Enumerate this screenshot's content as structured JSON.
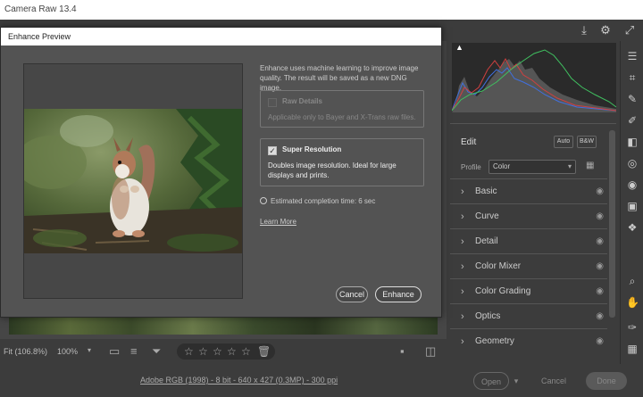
{
  "window": {
    "title": "Camera Raw 13.4"
  },
  "topbar": {
    "icons": [
      "save-icon",
      "gear-icon",
      "fullscreen-icon"
    ]
  },
  "bottombar": {
    "zoom_label": "Fit (106.8%)",
    "zoom_pct": "100%",
    "rating_stars": 5
  },
  "footer": {
    "info": "Adobe RGB (1998) - 8 bit - 640 x 427 (0.3MP) - 300 ppi",
    "open_label": "Open",
    "cancel_label": "Cancel",
    "done_label": "Done"
  },
  "right_panel": {
    "edit_title": "Edit",
    "auto_label": "Auto",
    "bw_label": "B&W",
    "profile_label": "Profile",
    "profile_value": "Color",
    "sections": [
      "Basic",
      "Curve",
      "Detail",
      "Color Mixer",
      "Color Grading",
      "Optics",
      "Geometry"
    ]
  },
  "dialog": {
    "title": "Enhance Preview",
    "description": "Enhance uses machine learning to improve image quality. The result will be saved as a new DNG image.",
    "raw_details": {
      "title": "Raw Details",
      "desc": "Applicable only to Bayer and X-Trans raw files.",
      "checked": false
    },
    "super_resolution": {
      "title": "Super Resolution",
      "desc": "Doubles image resolution. Ideal for large displays and prints.",
      "checked": true
    },
    "estimate": "Estimated completion time: 6 sec",
    "learn_more": "Learn More",
    "cancel_label": "Cancel",
    "enhance_label": "Enhance"
  },
  "colors": {
    "panel": "#3c3c3c",
    "dialog": "#535353",
    "hist_red": "#d04040",
    "hist_green": "#40c060",
    "hist_blue": "#4070e0"
  }
}
